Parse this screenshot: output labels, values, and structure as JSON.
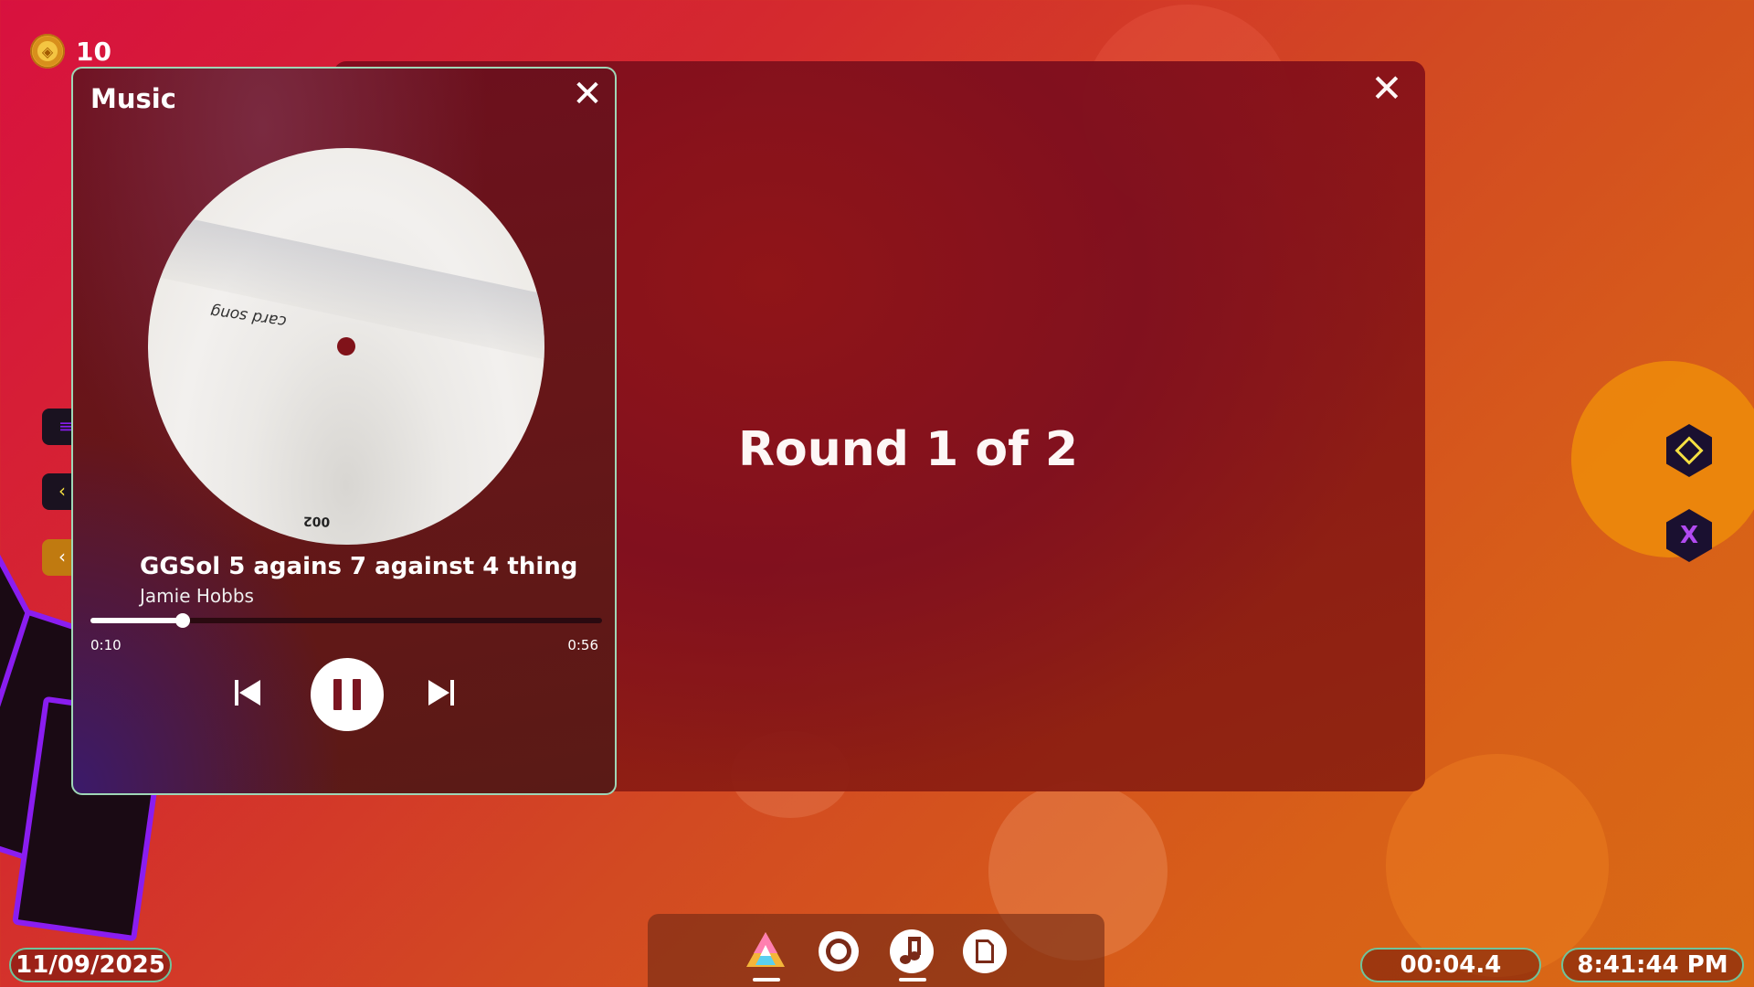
{
  "coins": {
    "count": "10",
    "icon": "coin-icon"
  },
  "round_panel": {
    "title": "Round 1 of 2",
    "close_icon": "close-icon"
  },
  "music": {
    "title": "Music",
    "close_icon": "close-icon",
    "album_label": "card song",
    "album_number": "002",
    "track_title": "GGSol 5 agains 7 against 4 thing",
    "artist": "Jamie Hobbs",
    "current_time": "0:10",
    "total_time": "0:56",
    "progress": 0.18
  },
  "side_buttons": [
    {
      "icon": "diamond-icon"
    },
    {
      "label": "X",
      "icon": "x-icon"
    }
  ],
  "dock": [
    {
      "icon": "prism-icon",
      "active": true
    },
    {
      "icon": "gear-icon",
      "active": false
    },
    {
      "icon": "music-note-icon",
      "active": true
    },
    {
      "icon": "cards-icon",
      "active": false
    }
  ],
  "status": {
    "date": "11/09/2025",
    "timer": "00:04.4",
    "clock": "8:41:44 PM"
  },
  "colors": {
    "accent_green": "#6fc49c",
    "deck_purple": "#8a1df0",
    "diamond_yellow": "#f5e042"
  }
}
